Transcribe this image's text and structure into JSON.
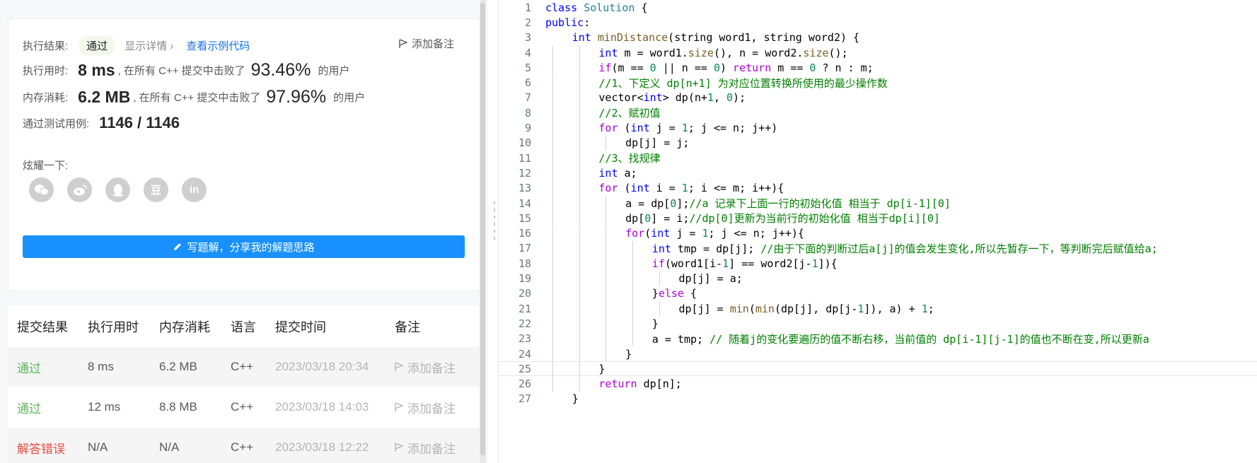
{
  "result": {
    "status_label": "执行结果:",
    "status_value": "通过",
    "show_detail": "显示详情 ›",
    "view_example": "查看示例代码",
    "add_note": "添加备注",
    "runtime_label": "执行用时:",
    "runtime_value": "8 ms",
    "runtime_mid": ", 在所有 C++ 提交中击败了",
    "runtime_pct": "93.46%",
    "runtime_tail": "的用户",
    "memory_label": "内存消耗:",
    "memory_value": "6.2 MB",
    "memory_mid": ", 在所有 C++ 提交中击败了",
    "memory_pct": "97.96%",
    "memory_tail": "的用户",
    "tests_label": "通过测试用例:",
    "tests_value": "1146 / 1146",
    "share_label": "炫耀一下:",
    "social_icons": [
      "wechat-icon",
      "weibo-icon",
      "qq-icon",
      "douban-icon",
      "linkedin-icon"
    ],
    "douban_glyph": "豆",
    "linkedin_glyph": "in",
    "write_solution": "写题解，分享我的解题思路"
  },
  "submissions": {
    "headers": [
      "提交结果",
      "执行用时",
      "内存消耗",
      "语言",
      "提交时间",
      "备注"
    ],
    "rows": [
      {
        "result": "通过",
        "status": "ok",
        "time": "8 ms",
        "memory": "6.2 MB",
        "lang": "C++",
        "date": "2023/03/18 20:34",
        "note": "添加备注"
      },
      {
        "result": "通过",
        "status": "ok",
        "time": "12 ms",
        "memory": "8.8 MB",
        "lang": "C++",
        "date": "2023/03/18 14:03",
        "note": "添加备注"
      },
      {
        "result": "解答错误",
        "status": "err",
        "time": "N/A",
        "memory": "N/A",
        "lang": "C++",
        "date": "2023/03/18 12:22",
        "note": "添加备注"
      }
    ]
  },
  "colors": {
    "keyword": "#0000ff",
    "type": "#0000ff",
    "control": "#af00db",
    "function": "#795e26",
    "class": "#267f99",
    "comment": "#008000",
    "number": "#098658",
    "accent_blue": "#1890ff",
    "pass_green": "#5cb85c",
    "error_red": "#e54d42"
  },
  "editor": {
    "lines": [
      {
        "n": "1",
        "indent": 0,
        "tokens": [
          [
            "kw",
            "class"
          ],
          [
            "p",
            " "
          ],
          [
            "cls",
            "Solution"
          ],
          [
            "p",
            " {"
          ]
        ]
      },
      {
        "n": "2",
        "indent": 0,
        "tokens": [
          [
            "kw",
            "public"
          ],
          [
            "p",
            ":"
          ]
        ]
      },
      {
        "n": "3",
        "indent": 1,
        "tokens": [
          [
            "kw",
            "int"
          ],
          [
            "p",
            " "
          ],
          [
            "fn",
            "minDistance"
          ],
          [
            "p",
            "("
          ],
          [
            "p",
            "string word1, "
          ],
          [
            "p",
            "string word2) {"
          ]
        ]
      },
      {
        "n": "4",
        "indent": 2,
        "tokens": [
          [
            "kw",
            "int"
          ],
          [
            "p",
            " m = word1."
          ],
          [
            "fn",
            "size"
          ],
          [
            "p",
            "(), n = word2."
          ],
          [
            "fn",
            "size"
          ],
          [
            "p",
            "();"
          ]
        ]
      },
      {
        "n": "5",
        "indent": 2,
        "tokens": [
          [
            "ctl",
            "if"
          ],
          [
            "p",
            "(m == "
          ],
          [
            "num",
            "0"
          ],
          [
            "p",
            " || n == "
          ],
          [
            "num",
            "0"
          ],
          [
            "p",
            ") "
          ],
          [
            "ctl",
            "return"
          ],
          [
            "p",
            " m == "
          ],
          [
            "num",
            "0"
          ],
          [
            "p",
            " ? n : m;"
          ]
        ]
      },
      {
        "n": "6",
        "indent": 2,
        "tokens": [
          [
            "cm",
            "//1、下定义 dp[n+1] 为对应位置转换所使用的最少操作数"
          ]
        ]
      },
      {
        "n": "7",
        "indent": 2,
        "tokens": [
          [
            "p",
            "vector<"
          ],
          [
            "kw",
            "int"
          ],
          [
            "p",
            "> dp(n+"
          ],
          [
            "num",
            "1"
          ],
          [
            "p",
            ", "
          ],
          [
            "num",
            "0"
          ],
          [
            "p",
            ");"
          ]
        ]
      },
      {
        "n": "8",
        "indent": 2,
        "tokens": [
          [
            "cm",
            "//2、赋初值"
          ]
        ]
      },
      {
        "n": "9",
        "indent": 2,
        "tokens": [
          [
            "ctl",
            "for"
          ],
          [
            "p",
            " ("
          ],
          [
            "kw",
            "int"
          ],
          [
            "p",
            " j = "
          ],
          [
            "num",
            "1"
          ],
          [
            "p",
            "; j <= n; j++)"
          ]
        ]
      },
      {
        "n": "10",
        "indent": 3,
        "tokens": [
          [
            "p",
            "dp[j] = j;"
          ]
        ]
      },
      {
        "n": "11",
        "indent": 2,
        "tokens": [
          [
            "cm",
            "//3、找规律"
          ]
        ]
      },
      {
        "n": "12",
        "indent": 2,
        "tokens": [
          [
            "kw",
            "int"
          ],
          [
            "p",
            " a;"
          ]
        ]
      },
      {
        "n": "13",
        "indent": 2,
        "tokens": [
          [
            "ctl",
            "for"
          ],
          [
            "p",
            " ("
          ],
          [
            "kw",
            "int"
          ],
          [
            "p",
            " i = "
          ],
          [
            "num",
            "1"
          ],
          [
            "p",
            "; i <= m; i++){"
          ]
        ]
      },
      {
        "n": "14",
        "indent": 3,
        "tokens": [
          [
            "p",
            "a = dp["
          ],
          [
            "num",
            "0"
          ],
          [
            "p",
            "];"
          ],
          [
            "cm",
            "//a 记录下上面一行的初始化值 相当于 dp[i-1][0]"
          ]
        ]
      },
      {
        "n": "15",
        "indent": 3,
        "tokens": [
          [
            "p",
            "dp["
          ],
          [
            "num",
            "0"
          ],
          [
            "p",
            "] = i;"
          ],
          [
            "cm",
            "//dp[0]更新为当前行的初始化值 相当于dp[i][0]"
          ]
        ]
      },
      {
        "n": "16",
        "indent": 3,
        "tokens": [
          [
            "ctl",
            "for"
          ],
          [
            "p",
            "("
          ],
          [
            "kw",
            "int"
          ],
          [
            "p",
            " j = "
          ],
          [
            "num",
            "1"
          ],
          [
            "p",
            "; j <= n; j++){"
          ]
        ]
      },
      {
        "n": "17",
        "indent": 4,
        "tokens": [
          [
            "kw",
            "int"
          ],
          [
            "p",
            " tmp = dp[j]; "
          ],
          [
            "cm",
            "//由于下面的判断过后a[j]的值会发生变化,所以先暂存一下，等判断完后赋值给a;"
          ]
        ]
      },
      {
        "n": "18",
        "indent": 4,
        "tokens": [
          [
            "ctl",
            "if"
          ],
          [
            "p",
            "(word1[i-"
          ],
          [
            "num",
            "1"
          ],
          [
            "p",
            "] == word2[j-"
          ],
          [
            "num",
            "1"
          ],
          [
            "p",
            "]){"
          ]
        ]
      },
      {
        "n": "19",
        "indent": 5,
        "tokens": [
          [
            "p",
            "dp[j] = a;"
          ]
        ]
      },
      {
        "n": "20",
        "indent": 4,
        "tokens": [
          [
            "p",
            "}"
          ],
          [
            "ctl",
            "else"
          ],
          [
            "p",
            " {"
          ]
        ]
      },
      {
        "n": "21",
        "indent": 5,
        "tokens": [
          [
            "p",
            "dp[j] = "
          ],
          [
            "fn",
            "min"
          ],
          [
            "p",
            "("
          ],
          [
            "fn",
            "min"
          ],
          [
            "p",
            "(dp[j], dp[j-"
          ],
          [
            "num",
            "1"
          ],
          [
            "p",
            "]), a) + "
          ],
          [
            "num",
            "1"
          ],
          [
            "p",
            ";"
          ]
        ]
      },
      {
        "n": "22",
        "indent": 4,
        "tokens": [
          [
            "p",
            "}"
          ]
        ]
      },
      {
        "n": "23",
        "indent": 4,
        "tokens": [
          [
            "p",
            "a = tmp; "
          ],
          [
            "cm",
            "// 随着j的变化要遍历的值不断右移，当前值的 dp[i-1][j-1]的值也不断在变,所以更新a"
          ]
        ]
      },
      {
        "n": "24",
        "indent": 3,
        "tokens": [
          [
            "p",
            "}"
          ]
        ]
      },
      {
        "n": "25",
        "indent": 2,
        "tokens": [
          [
            "p",
            "}"
          ]
        ]
      },
      {
        "n": "26",
        "indent": 2,
        "tokens": [
          [
            "ctl",
            "return"
          ],
          [
            "p",
            " dp[n];"
          ]
        ]
      },
      {
        "n": "27",
        "indent": 1,
        "tokens": [
          [
            "p",
            "}"
          ]
        ]
      }
    ]
  }
}
